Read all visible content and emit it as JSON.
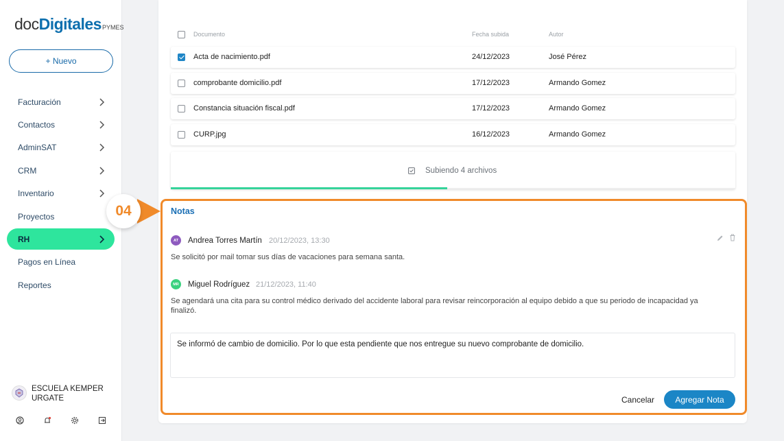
{
  "brand": {
    "part1": "doc",
    "part2": "Digitales",
    "part3": "PYMES"
  },
  "new_button": "+ Nuevo",
  "nav": [
    {
      "label": "Facturación",
      "chevron": true,
      "active": false
    },
    {
      "label": "Contactos",
      "chevron": true,
      "active": false
    },
    {
      "label": "AdminSAT",
      "chevron": true,
      "active": false
    },
    {
      "label": "CRM",
      "chevron": true,
      "active": false
    },
    {
      "label": "Inventario",
      "chevron": true,
      "active": false
    },
    {
      "label": "Proyectos",
      "chevron": false,
      "active": false
    },
    {
      "label": "RH",
      "chevron": true,
      "active": true
    },
    {
      "label": "Pagos en Línea",
      "chevron": false,
      "active": false
    },
    {
      "label": "Reportes",
      "chevron": false,
      "active": false
    }
  ],
  "org": {
    "name": "ESCUELA KEMPER URGATE"
  },
  "table": {
    "headers": {
      "document": "Documento",
      "date": "Fecha subida",
      "author": "Autor"
    },
    "rows": [
      {
        "document": "Acta de nacimiento.pdf",
        "date": "24/12/2023",
        "author": "José Pérez",
        "checked": true
      },
      {
        "document": "comprobante domicilio.pdf",
        "date": "17/12/2023",
        "author": "Armando Gomez",
        "checked": false
      },
      {
        "document": "Constancia situación fiscal.pdf",
        "date": "17/12/2023",
        "author": "Armando Gomez",
        "checked": false
      },
      {
        "document": "CURP.jpg",
        "date": "16/12/2023",
        "author": "Armando Gomez",
        "checked": false
      }
    ]
  },
  "upload": {
    "text": "Subiendo 4 archivos",
    "progress": 0.49,
    "bar_color": "#35d39a"
  },
  "step_marker": "04",
  "notes": {
    "title": "Notas",
    "items": [
      {
        "initials": "AT",
        "avatar_color": "#8e5bbf",
        "author": "Andrea Torres Martín",
        "datetime": "20/12/2023, 13:30",
        "text": "Se solicitó por mail tomar sus días de vacaciones para semana santa."
      },
      {
        "initials": "MR",
        "avatar_color": "#3bd17f",
        "author": "Miguel Rodríguez",
        "datetime": "21/12/2023, 11:40",
        "text": "Se agendará una cita para su control médico derivado del accidente laboral para revisar reincorporación al equipo debido a que su periodo de incapacidad ya finalizó."
      }
    ],
    "input_value": "Se informó de cambio de domicilio. Por lo que esta pendiente que nos entregue su nuevo comprobante de domicilio.",
    "cancel_label": "Cancelar",
    "add_label": "Agregar Nota"
  },
  "colors": {
    "accent": "#1b86c6",
    "active_nav": "#2ee59d",
    "highlight": "#f08a2a"
  }
}
